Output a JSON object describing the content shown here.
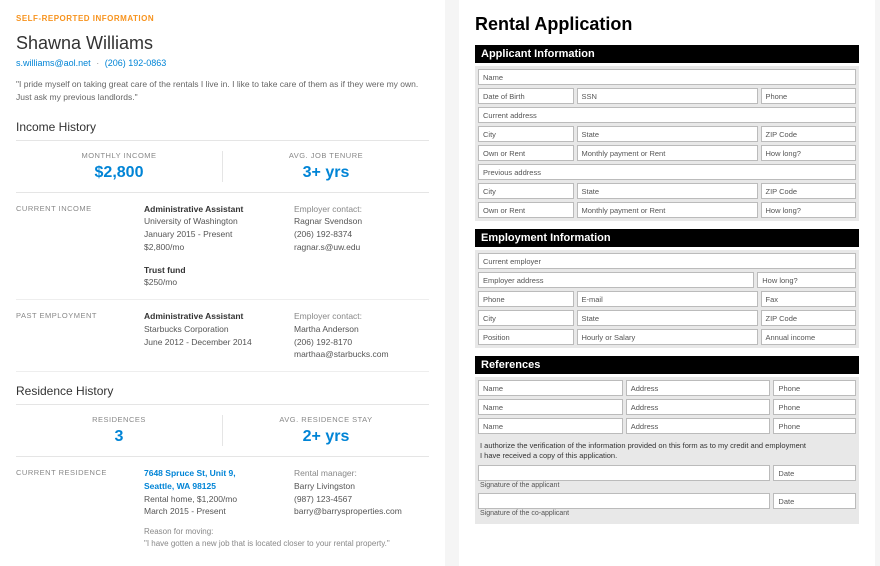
{
  "left": {
    "badge": "SELF-REPORTED INFORMATION",
    "name": "Shawna Williams",
    "email": "s.williams@aol.net",
    "phone": "(206) 192-0863",
    "quote": "\"I pride myself on taking great care of the rentals I live in. I like to take care of them as if they were my own. Just ask my previous landlords.\"",
    "income_history": {
      "title": "Income History",
      "stat1_label": "MONTHLY INCOME",
      "stat1_value": "$2,800",
      "stat2_label": "AVG. JOB TENURE",
      "stat2_value": "3+ yrs",
      "current_label": "CURRENT INCOME",
      "current": {
        "job1_title": "Administrative Assistant",
        "job1_org": "University of Washington",
        "job1_dates": "January 2015 - Present",
        "job1_pay": "$2,800/mo",
        "job1_contact_label": "Employer contact:",
        "job1_contact_name": "Ragnar Svendson",
        "job1_contact_phone": "(206) 192-8374",
        "job1_contact_email": "ragnar.s@uw.edu",
        "job2_title": "Trust fund",
        "job2_pay": "$250/mo"
      },
      "past_label": "PAST EMPLOYMENT",
      "past": {
        "job1_title": "Administrative Assistant",
        "job1_org": "Starbucks Corporation",
        "job1_dates": "June 2012 - December 2014",
        "job1_contact_label": "Employer contact:",
        "job1_contact_name": "Martha Anderson",
        "job1_contact_phone": "(206) 192-8170",
        "job1_contact_email": "marthaa@starbucks.com"
      }
    },
    "residence_history": {
      "title": "Residence History",
      "stat1_label": "RESIDENCES",
      "stat1_value": "3",
      "stat2_label": "AVG. RESIDENCE STAY",
      "stat2_value": "2+ yrs",
      "current_label": "CURRENT RESIDENCE",
      "current": {
        "addr1": "7648 Spruce St, Unit 9,",
        "addr2": "Seattle, WA 98125",
        "desc": "Rental home, $1,200/mo",
        "dates": "March 2015 - Present",
        "mgr_label": "Rental manager:",
        "mgr_name": "Barry Livingston",
        "mgr_phone": "(987) 123-4567",
        "mgr_email": "barry@barrysproperties.com",
        "reason_label": "Reason for moving:",
        "reason": "\"I have gotten a new job that is located closer to your rental property.\""
      }
    }
  },
  "right": {
    "title": "Rental Application",
    "sections": {
      "applicant": "Applicant Information",
      "employment": "Employment Information",
      "references": "References"
    },
    "fields": {
      "name": "Name",
      "dob": "Date of Birth",
      "ssn": "SSN",
      "phone": "Phone",
      "cur_addr": "Current address",
      "city": "City",
      "state": "State",
      "zip": "ZIP Code",
      "own_rent": "Own or Rent",
      "monthly": "Monthly payment or Rent",
      "how_long": "How long?",
      "prev_addr": "Previous address",
      "cur_employer": "Current employer",
      "emp_addr": "Employer address",
      "email": "E-mail",
      "fax": "Fax",
      "position": "Position",
      "hourly": "Hourly or Salary",
      "annual": "Annual income",
      "address": "Address",
      "date": "Date"
    },
    "auth1": "I authorize the verification of the information provided on this form as to my credit and employment",
    "auth2": "I have received a copy of this application.",
    "sig1": "Signature of the applicant",
    "sig2": "Signature of the co-applicant"
  }
}
